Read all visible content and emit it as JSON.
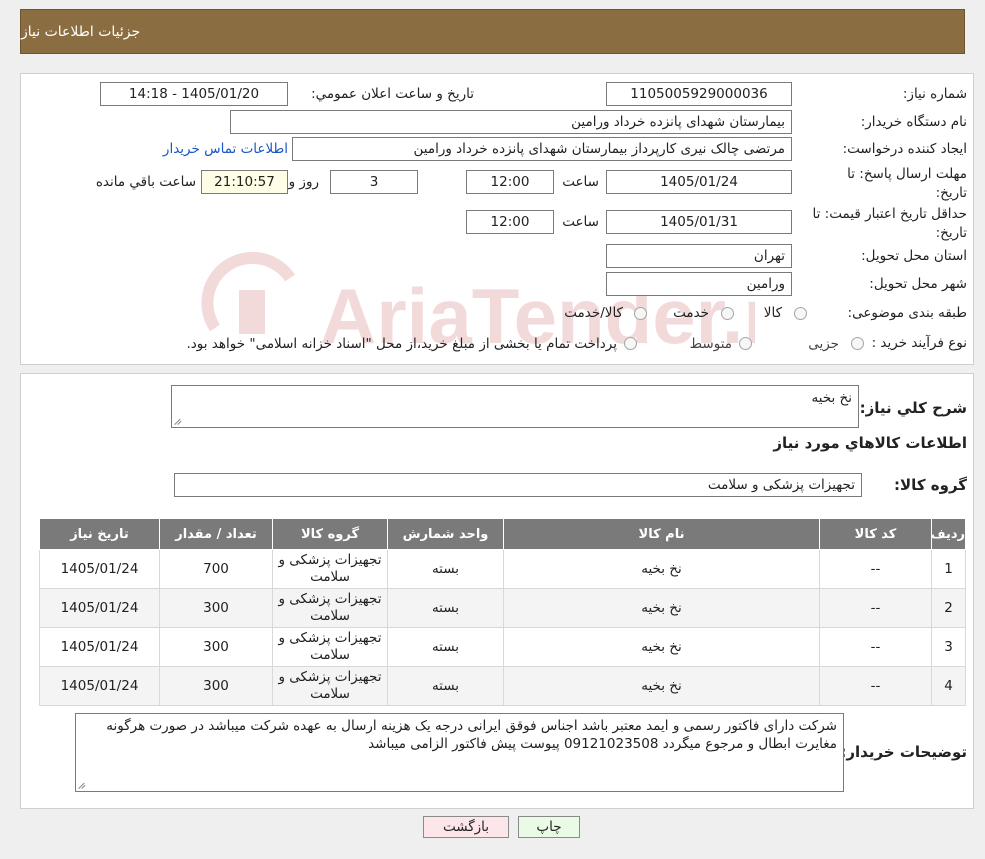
{
  "header": {
    "title": "جزئیات اطلاعات نیاز"
  },
  "form": {
    "need_number_label": "شماره نیاز:",
    "need_number": "1105005929000036",
    "announce_datetime_label": "تاریخ و ساعت اعلان عمومي:",
    "announce_datetime": "1405/01/20 - 14:18",
    "buyer_org_label": "نام دستگاه خريدار:",
    "buyer_org": "بیمارستان شهدای پانزده خرداد ورامین",
    "requester_label": "ايجاد کننده درخواست:",
    "requester": "مرتضی چالک نیری کارپرداز بیمارستان شهدای پانزده خرداد ورامین",
    "buyer_contact_link": "اطلاعات تماس خريدار",
    "reply_deadline_label_1": "مهلت ارسال پاسخ: تا",
    "reply_deadline_label_2": "تاريخ:",
    "reply_date": "1405/01/24",
    "time_label": "ساعت",
    "reply_time": "12:00",
    "days_value": "3",
    "days_label": "روز و",
    "remaining_time": "21:10:57",
    "remaining_label": "ساعت باقي مانده",
    "validity_label_1": "حداقل تاريخ اعتبار قيمت: تا",
    "validity_label_2": "تاريخ:",
    "validity_date": "1405/01/31",
    "validity_time": "12:00",
    "province_label": "استان محل تحويل:",
    "province": "تهران",
    "city_label": "شهر محل تحويل:",
    "city": "ورامین",
    "category_label": "طبقه بندی موضوعی:",
    "category_options": [
      "کالا",
      "خدمت",
      "کالا/خدمت"
    ],
    "purchase_type_label": "نوع فرآيند خريد :",
    "purchase_options": [
      "جزیی",
      "متوسط"
    ],
    "purchase_note": "پرداخت تمام یا بخشی از مبلغ خرید،از محل \"اسناد خزانه اسلامی\" خواهد بود."
  },
  "details": {
    "summary_label": "شرح كلي نياز:",
    "summary": "نخ بخیه",
    "items_heading": "اطلاعات کالاهاي مورد نياز",
    "group_label": "گروه کالا:",
    "group": "تجهیزات پزشکی و سلامت",
    "table": {
      "headers": [
        "رديف",
        "کد کالا",
        "نام کالا",
        "واحد شمارش",
        "گروه کالا",
        "تعداد / مقدار",
        "تاريخ نياز"
      ],
      "rows": [
        [
          "1",
          "--",
          "نخ بخیه",
          "بسته",
          "تجهیزات پزشکی و سلامت",
          "700",
          "1405/01/24"
        ],
        [
          "2",
          "--",
          "نخ بخیه",
          "بسته",
          "تجهیزات پزشکی و سلامت",
          "300",
          "1405/01/24"
        ],
        [
          "3",
          "--",
          "نخ بخیه",
          "بسته",
          "تجهیزات پزشکی و سلامت",
          "300",
          "1405/01/24"
        ],
        [
          "4",
          "--",
          "نخ بخیه",
          "بسته",
          "تجهیزات پزشکی و سلامت",
          "300",
          "1405/01/24"
        ]
      ]
    },
    "buyer_notes_label": "توضيحات خريدار:",
    "buyer_notes": "شرکت دارای فاکتور رسمی و ایمد معتبر باشد اجناس فوقق ایرانی درجه یک هزینه ارسال به عهده شرکت میباشد در صورت هرگونه مغایرت ابطال و مرجوع میگردد 09121023508 پیوست پیش فاکتور الزامی میباشد"
  },
  "buttons": {
    "print": "چاپ",
    "back": "بازگشت"
  },
  "watermark": {
    "text": "AriaTender.neT"
  },
  "colors": {
    "header_bg": "#8b6d42",
    "link": "#1a56c8",
    "back_button_bg": "#fde6ea",
    "print_button_bg": "#e9fbe5"
  }
}
